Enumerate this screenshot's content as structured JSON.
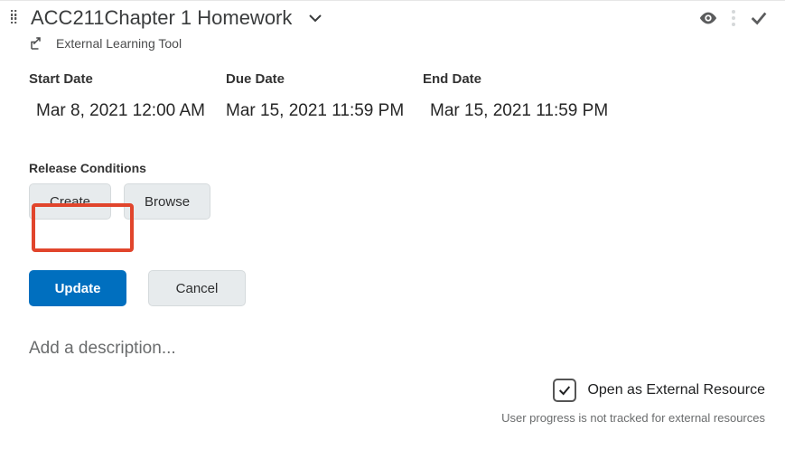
{
  "title": "ACC211Chapter 1 Homework",
  "tool_label": "External Learning Tool",
  "dates": {
    "start": {
      "label": "Start Date",
      "value": "Mar 8, 2021 12:00 AM"
    },
    "due": {
      "label": "Due Date",
      "value": "Mar 15, 2021 11:59 PM"
    },
    "end": {
      "label": "End Date",
      "value": "Mar 15, 2021 11:59 PM"
    }
  },
  "release_conditions": {
    "label": "Release Conditions",
    "create": "Create",
    "browse": "Browse"
  },
  "actions": {
    "update": "Update",
    "cancel": "Cancel"
  },
  "description_placeholder": "Add a description...",
  "open_external": {
    "label": "Open as External Resource",
    "checked": true
  },
  "footnote": "User progress is not tracked for external resources"
}
